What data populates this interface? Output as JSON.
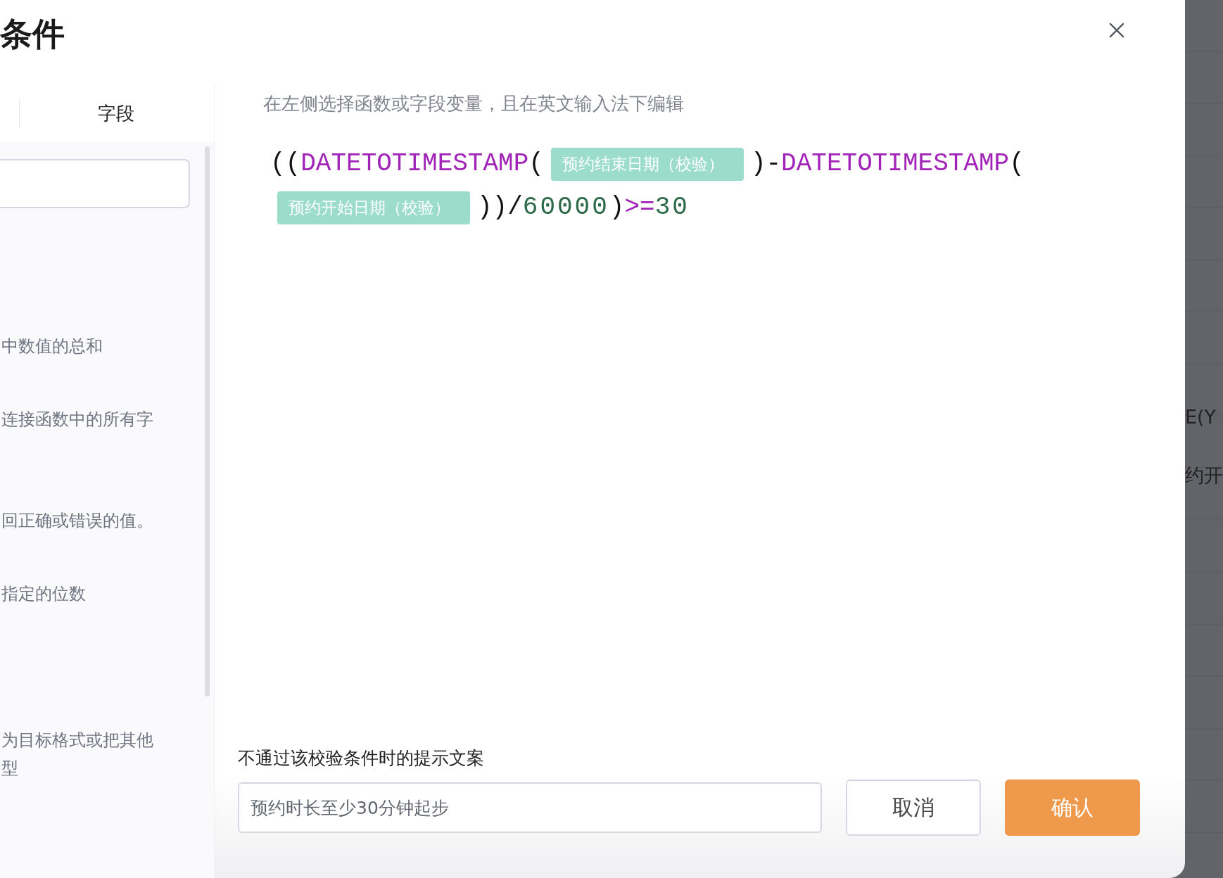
{
  "dialog": {
    "title": "条件",
    "tab": {
      "label": "字段"
    },
    "function_descriptions": [
      "中数值的总和",
      "连接函数中的所有字",
      "回正确或错误的值。",
      "指定的位数",
      "为目标格式或把其他型"
    ],
    "editor": {
      "hint": "在左侧选择函数或字段变量，且在英文输入法下编辑",
      "formula": [
        {
          "kind": "paren",
          "text": "(("
        },
        {
          "kind": "func",
          "text": "DATETOTIMESTAMP"
        },
        {
          "kind": "paren",
          "text": "("
        },
        {
          "kind": "field",
          "text": "预约结束日期（校验）"
        },
        {
          "kind": "paren",
          "text": ")-"
        },
        {
          "kind": "func",
          "text": "DATETOTIMESTAMP"
        },
        {
          "kind": "paren",
          "text": "("
        },
        {
          "kind": "field",
          "text": "预约开始日期（校验）"
        },
        {
          "kind": "paren",
          "text": "))/"
        },
        {
          "kind": "number",
          "text": "60000"
        },
        {
          "kind": "paren",
          "text": ")"
        },
        {
          "kind": "op",
          "text": ">="
        },
        {
          "kind": "number",
          "text": "30"
        }
      ]
    },
    "message": {
      "label": "不通过该校验条件时的提示文案",
      "value": "预约时长至少30分钟起步"
    },
    "buttons": [
      {
        "kind": "secondary",
        "label": "取消"
      },
      {
        "kind": "primary",
        "label": "确认"
      }
    ]
  },
  "background_fragments": [
    "E(Y",
    "约开"
  ]
}
